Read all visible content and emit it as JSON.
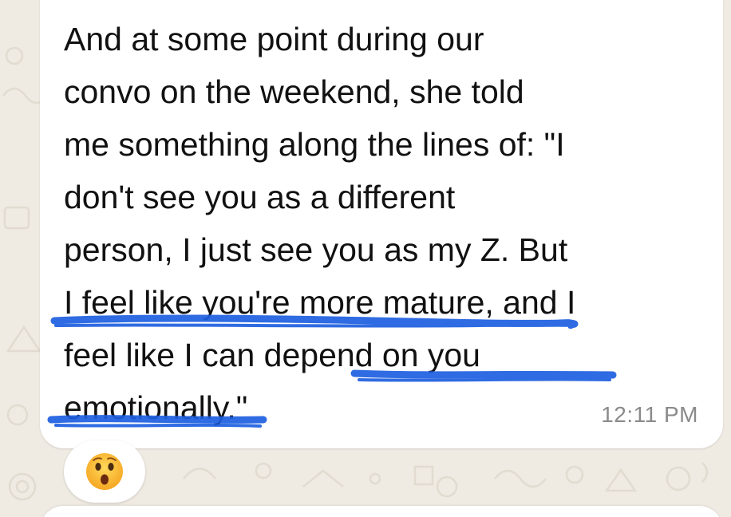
{
  "message": {
    "lines": [
      "And at some point during our",
      "convo on the weekend, she told",
      "me something along the lines of: \"I",
      "don't see you as a different",
      "person, I just see you as my Z. But",
      "I feel like you're more mature, and I",
      "feel like I can depend on you",
      "emotionally.\""
    ],
    "time": "12:11 PM"
  },
  "reaction": {
    "emoji": "astonished-face-icon"
  },
  "colors": {
    "chat_background": "#efeae2",
    "bubble": "#ffffff",
    "text": "#111111",
    "timestamp": "#8a8a8a",
    "highlight_scribble": "#1e5fe0"
  }
}
